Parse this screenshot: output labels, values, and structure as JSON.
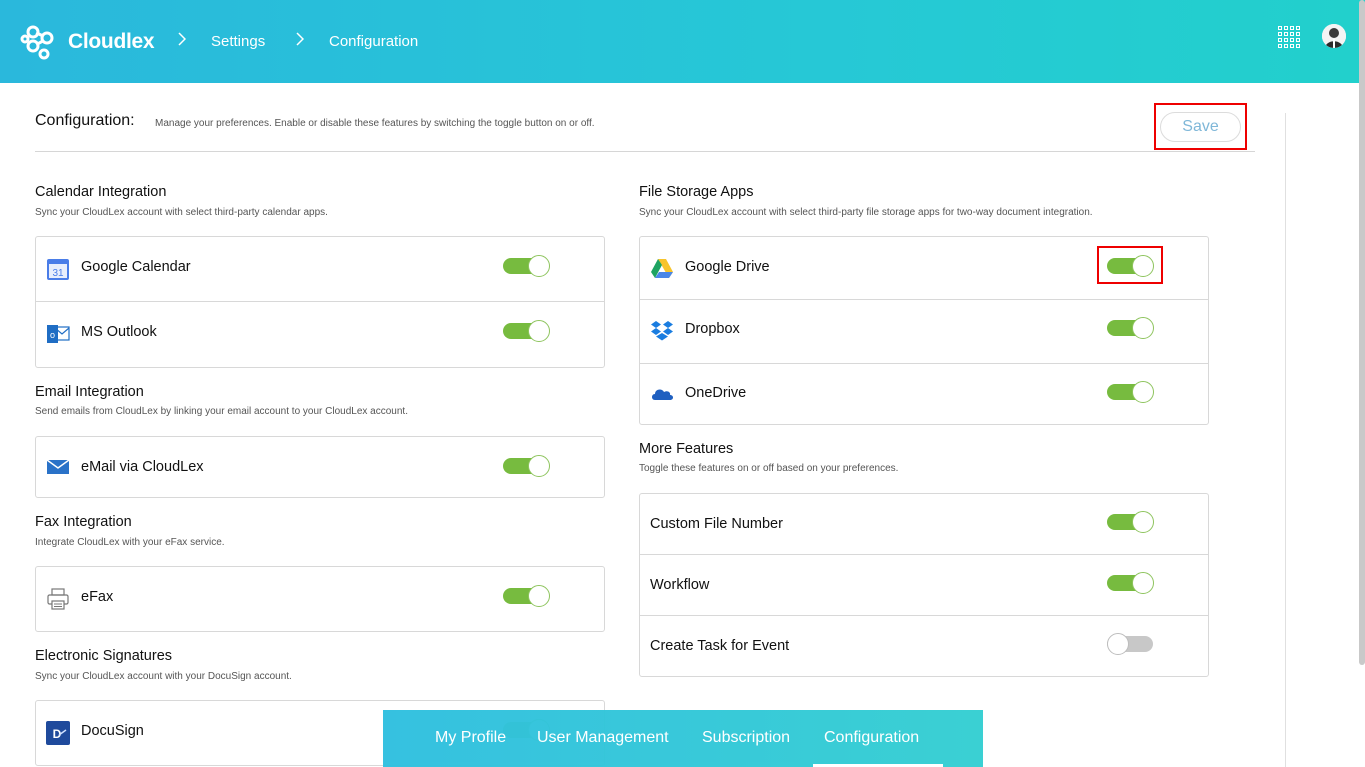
{
  "header": {
    "brand": "Cloudlex",
    "breadcrumbs": [
      {
        "label": "Settings"
      },
      {
        "label": "Configuration"
      }
    ],
    "separator": ">"
  },
  "config": {
    "title": "Configuration:",
    "subtitle": "Manage your preferences. Enable or disable these features by switching the toggle button on or off.",
    "save_label": "Save"
  },
  "sections": {
    "calendar": {
      "title": "Calendar Integration",
      "subtitle": "Sync your CloudLex account with select third-party calendar apps.",
      "items": [
        {
          "label": "Google Calendar",
          "icon": "google-calendar-icon",
          "enabled": true
        },
        {
          "label": "MS Outlook",
          "icon": "outlook-icon",
          "enabled": true
        }
      ]
    },
    "email": {
      "title": "Email Integration",
      "subtitle": "Send emails from CloudLex by linking your email account to your CloudLex account.",
      "items": [
        {
          "label": "eMail via CloudLex",
          "icon": "envelope-icon",
          "enabled": true
        }
      ]
    },
    "fax": {
      "title": "Fax Integration",
      "subtitle": "Integrate CloudLex with your eFax service.",
      "items": [
        {
          "label": "eFax",
          "icon": "printer-icon",
          "enabled": true
        }
      ]
    },
    "esign": {
      "title": "Electronic Signatures",
      "subtitle": "Sync your CloudLex account with your DocuSign account.",
      "items": [
        {
          "label": "DocuSign",
          "icon": "docusign-icon",
          "enabled": true
        }
      ]
    },
    "storage": {
      "title": "File Storage Apps",
      "subtitle": "Sync your CloudLex account with select third-party file storage apps for two-way document integration.",
      "items": [
        {
          "label": "Google Drive",
          "icon": "google-drive-icon",
          "enabled": true
        },
        {
          "label": "Dropbox",
          "icon": "dropbox-icon",
          "enabled": true
        },
        {
          "label": "OneDrive",
          "icon": "onedrive-icon",
          "enabled": true
        }
      ]
    },
    "more": {
      "title": "More Features",
      "subtitle": "Toggle these features on or off based on your preferences.",
      "items": [
        {
          "label": "Custom File Number",
          "enabled": true
        },
        {
          "label": "Workflow",
          "enabled": true
        },
        {
          "label": "Create Task for Event",
          "enabled": false
        }
      ]
    }
  },
  "bottom_tabs": [
    {
      "label": "My Profile"
    },
    {
      "label": "User Management"
    },
    {
      "label": "Subscription"
    },
    {
      "label": "Configuration",
      "active": true
    }
  ],
  "colors": {
    "toggle_on": "#77bb3f",
    "toggle_off": "#c8c8c8",
    "header_start": "#2ab8dc",
    "header_end": "#22d0cc",
    "highlight": "#ee0000"
  }
}
